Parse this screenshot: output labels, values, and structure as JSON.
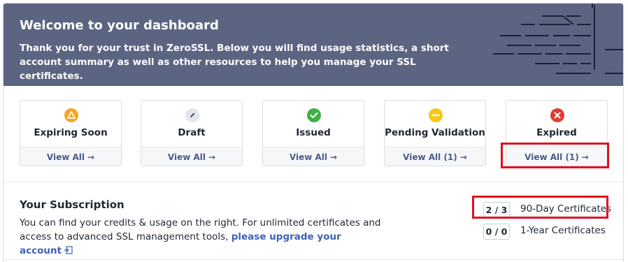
{
  "hero": {
    "title": "Welcome to your dashboard",
    "text": "Thank you for your trust in ZeroSSL. Below you will find usage statistics, a short account summary as well as other resources to help you manage your SSL certificates."
  },
  "cards": [
    {
      "label": "Expiring Soon",
      "link": "View All",
      "icon": "warning-triangle-icon",
      "color": "#f5a623"
    },
    {
      "label": "Draft",
      "link": "View All",
      "icon": "pencil-icon",
      "color": "#e3e6ec"
    },
    {
      "label": "Issued",
      "link": "View All",
      "icon": "check-icon",
      "color": "#3cb043"
    },
    {
      "label": "Pending Validation",
      "link": "View All (1)",
      "icon": "minus-icon",
      "color": "#f5c518"
    },
    {
      "label": "Expired",
      "link": "View All (1)",
      "icon": "close-x-icon",
      "color": "#e03b30"
    }
  ],
  "arrow_glyph": "→",
  "subscription": {
    "title": "Your Subscription",
    "text": "You can find your credits & usage on the right. For unlimited certificates and access to advanced SSL management tools,",
    "link": "please upgrade your account",
    "usage": [
      {
        "value": "2 / 3",
        "label": "90-Day Certificates"
      },
      {
        "value": "0 / 0",
        "label": "1-Year Certificates"
      }
    ]
  },
  "colors": {
    "hero_bg": "#5b6582",
    "link": "#4a5b8c",
    "highlight": "#e0101f"
  }
}
